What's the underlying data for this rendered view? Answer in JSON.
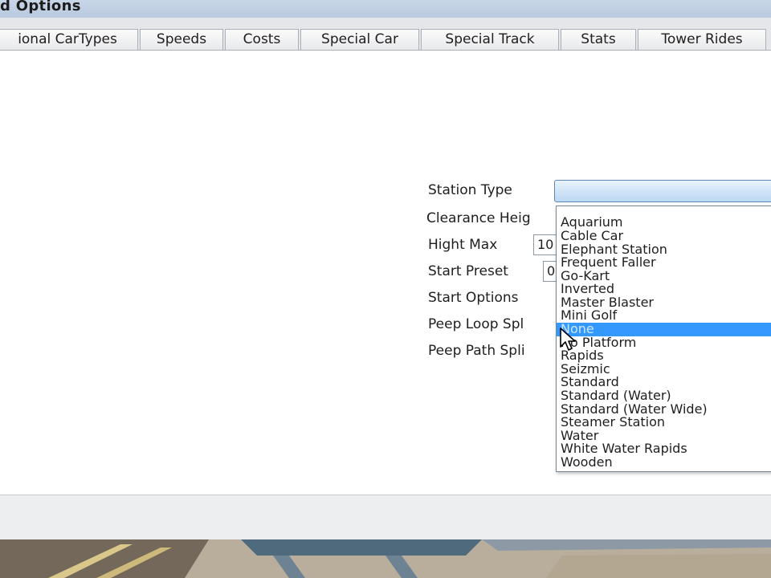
{
  "window": {
    "title": "d Options"
  },
  "tabs": [
    {
      "label": "ional CarTypes"
    },
    {
      "label": "Speeds"
    },
    {
      "label": "Costs"
    },
    {
      "label": "Special Car"
    },
    {
      "label": "Special Track"
    },
    {
      "label": "Stats"
    },
    {
      "label": "Tower Rides"
    }
  ],
  "form": {
    "station_type_label": "Station Type",
    "clearance_height_label": "Clearance Heig",
    "hight_max_label": "Hight Max",
    "hight_max_value": "10",
    "start_preset_label": "Start Preset",
    "start_preset_value": "0",
    "start_options_label": "Start Options",
    "peep_loop_split_label": "Peep Loop Spl",
    "peep_path_split_label": "Peep Path Spli",
    "station_type_value": ""
  },
  "station_type_options": [
    "Aquarium",
    "Cable Car",
    "Elephant Station",
    "Frequent Faller",
    "Go-Kart",
    "Inverted",
    "Master Blaster",
    "Mini Golf",
    "None",
    "No Platform",
    "Rapids",
    "Seizmic",
    "Standard",
    "Standard (Water)",
    "Standard (Water Wide)",
    "Steamer Station",
    "Water",
    "White Water Rapids",
    "Wooden"
  ],
  "station_type_selected": "None",
  "colors": {
    "selection": "#3399ff",
    "combo_border": "#5b86b8",
    "window_bg": "#ffffff"
  }
}
